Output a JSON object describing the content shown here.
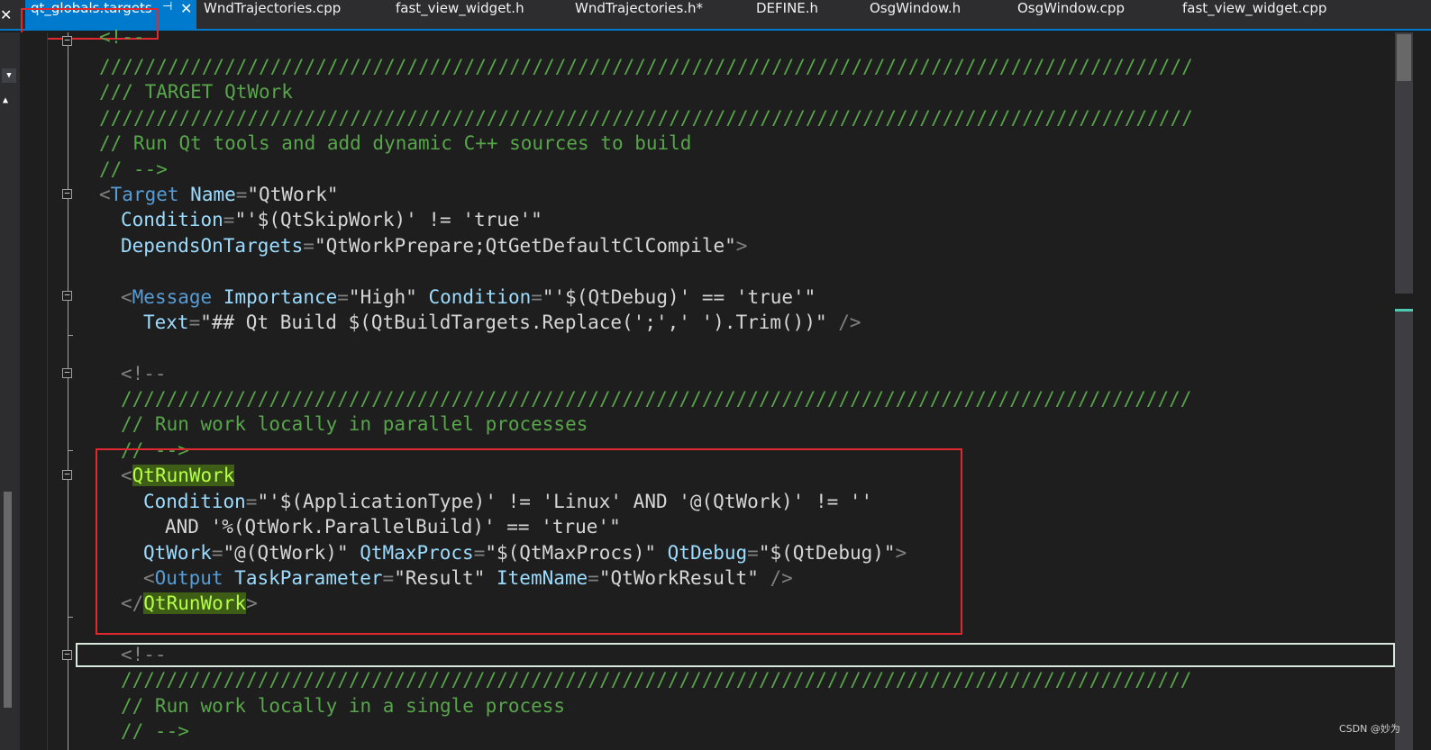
{
  "tabs": [
    {
      "label": "qt_globals.targets",
      "active": true
    },
    {
      "label": "WndTrajectories.cpp"
    },
    {
      "label": "fast_view_widget.h"
    },
    {
      "label": "WndTrajectories.h*"
    },
    {
      "label": "DEFINE.h"
    },
    {
      "label": "OsgWindow.h"
    },
    {
      "label": "OsgWindow.cpp"
    },
    {
      "label": "fast_view_widget.cpp"
    }
  ],
  "watermark": "CSDN @妙为",
  "code": {
    "l1_cmt": "<!--",
    "l2_cmt": "////////////////////////////////////////////////////////////////////////////////////////////////",
    "l3_cmt": "/// TARGET QtWork",
    "l4_cmt": "////////////////////////////////////////////////////////////////////////////////////////////////",
    "l5_cmt": "// Run Qt tools and add dynamic C++ sources to build",
    "l6_cmt": "// -->",
    "l7": {
      "open": "<",
      "tag": "Target",
      "attr1": "Name",
      "eq": "=",
      "val1": "\"QtWork\""
    },
    "l8": {
      "attr": "Condition",
      "eq": "=",
      "val": "\"'$(QtSkipWork)' != 'true'\""
    },
    "l9": {
      "attr": "DependsOnTargets",
      "eq": "=",
      "val": "\"QtWorkPrepare;QtGetDefaultClCompile\"",
      "close": ">"
    },
    "l11": {
      "open": "<",
      "tag": "Message",
      "attr1": "Importance",
      "eq1": "=",
      "val1": "\"High\"",
      "attr2": "Condition",
      "eq2": "=",
      "val2": "\"'$(QtDebug)' == 'true'\""
    },
    "l12": {
      "attr": "Text",
      "eq": "=",
      "val": "\"## Qt Build $(QtBuildTargets.Replace(';',' ').Trim())\"",
      "close": " />"
    },
    "l14_cmt": "<!--",
    "l15_cmt": "//////////////////////////////////////////////////////////////////////////////////////////////",
    "l16_cmt": "// Run work locally in parallel processes",
    "l17_cmt": "// -->",
    "l18": {
      "open": "<",
      "tag": "QtRunWork"
    },
    "l19": {
      "attr": "Condition",
      "eq": "=",
      "val": "\"'$(ApplicationType)' != 'Linux' AND '@(QtWork)' != ''"
    },
    "l20": {
      "val": "AND '%(QtWork.ParallelBuild)' == 'true'\""
    },
    "l21": {
      "attr1": "QtWork",
      "eq1": "=",
      "val1": "\"@(QtWork)\"",
      "attr2": "QtMaxProcs",
      "eq2": "=",
      "val2": "\"$(QtMaxProcs)\"",
      "attr3": "QtDebug",
      "eq3": "=",
      "val3": "\"$(QtDebug)\"",
      "close": ">"
    },
    "l22": {
      "open": "<",
      "tag": "Output",
      "attr1": "TaskParameter",
      "eq1": "=",
      "val1": "\"Result\"",
      "attr2": "ItemName",
      "eq2": "=",
      "val2": "\"QtWorkResult\"",
      "close": " />"
    },
    "l23": {
      "open": "</",
      "tag": "QtRunWork",
      "close": ">"
    },
    "l25_cmt": "<!--",
    "l26_cmt": "//////////////////////////////////////////////////////////////////////////////////////////////",
    "l27_cmt": "// Run work locally in a single process",
    "l28_cmt": "// -->"
  }
}
